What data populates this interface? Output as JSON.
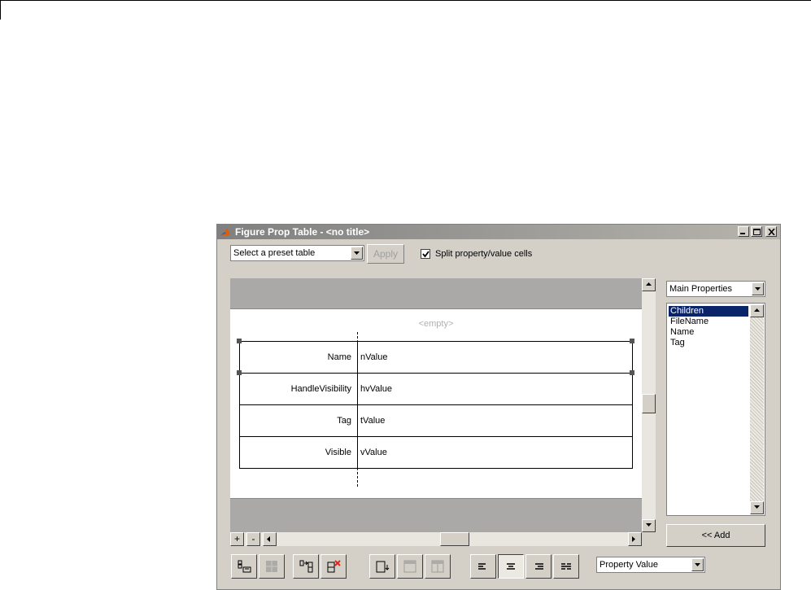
{
  "window": {
    "title": "Figure Prop Table - <no title>"
  },
  "toolbar": {
    "preset_select": "Select a preset table",
    "apply_label": "Apply",
    "split_checkbox_checked": true,
    "split_label": "Split property/value cells"
  },
  "canvas": {
    "empty_placeholder": "<empty>",
    "rows": [
      {
        "property": "Name",
        "value": "nValue"
      },
      {
        "property": "HandleVisibility",
        "value": "hvValue"
      },
      {
        "property": "Tag",
        "value": "tValue"
      },
      {
        "property": "Visible",
        "value": "vValue"
      }
    ],
    "zoom_in_label": "+",
    "zoom_out_label": "-"
  },
  "side_panel": {
    "category_select": "Main Properties",
    "properties": [
      "Children",
      "FileName",
      "Name",
      "Tag"
    ],
    "selected_property": "Children",
    "add_label": "<< Add"
  },
  "bottom_toolbar": {
    "buttons": [
      {
        "icon": "insert-row-icon",
        "enabled": true
      },
      {
        "icon": "merge-cells-icon",
        "enabled": false
      },
      {
        "icon": "insert-column-icon",
        "enabled": true
      },
      {
        "icon": "delete-row-icon",
        "enabled": true
      },
      {
        "icon": "split-vertical-icon",
        "enabled": true
      },
      {
        "icon": "table-header-icon",
        "enabled": false
      },
      {
        "icon": "table-footer-icon",
        "enabled": false
      },
      {
        "icon": "align-left-icon",
        "enabled": true
      },
      {
        "icon": "align-center-icon",
        "enabled": true,
        "active": true
      },
      {
        "icon": "align-right-icon",
        "enabled": true
      },
      {
        "icon": "distribute-icon",
        "enabled": true
      }
    ],
    "cell_mode_select": "Property Value"
  },
  "colors": {
    "titlebar_start": "#808080",
    "titlebar_end": "#b7b4ad",
    "window_face": "#d4d0c8",
    "list_selection": "#0a246a",
    "delete_accent": "#e0241b",
    "band_gray": "#aaa9a8"
  }
}
